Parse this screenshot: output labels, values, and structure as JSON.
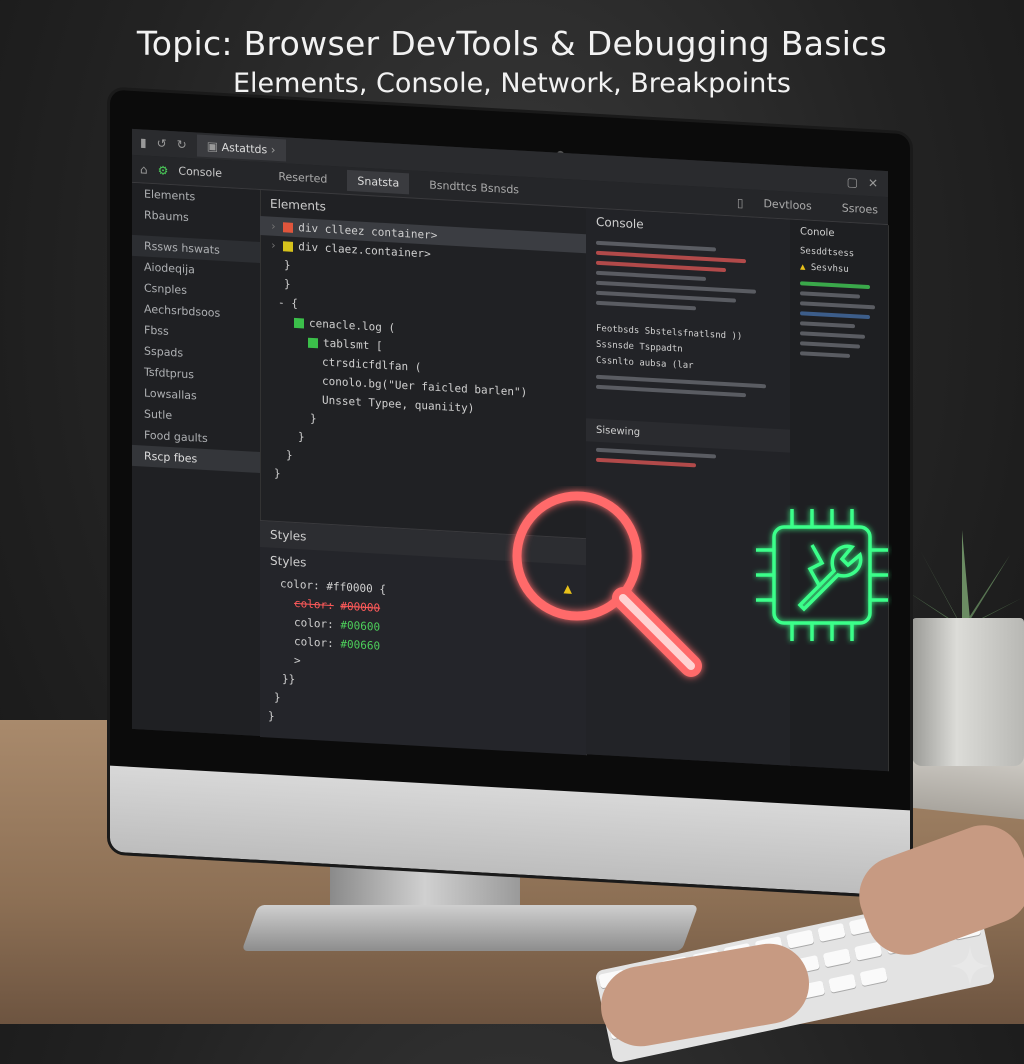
{
  "title": {
    "line1": "Topic: Browser DevTools & Debugging Basics",
    "line2": "Elements, Console, Network, Breakpoints"
  },
  "window": {
    "address_tab": "Astattds",
    "panel_label": "Console",
    "tabs": [
      "Reserted",
      "Snatsta",
      "Bsndttcs Bsnsds"
    ],
    "right_tabs": [
      "Devtloos",
      "Ssroes"
    ]
  },
  "sidebar": {
    "items": [
      "Elements",
      "Rbaums",
      "Rssws hswats",
      "Aiodeqija",
      "Csnples",
      "Aechsrbdsoos",
      "Fbss",
      "Sspads",
      "Tsfdtprus",
      "Lowsallas",
      "Sutle",
      "Food gaults",
      "Rscp fbes"
    ],
    "active_index": 12
  },
  "elements_panel": {
    "title": "Elements",
    "lines": [
      "div clleez container>",
      "div claez.container>",
      "}",
      "}",
      "- {",
      "cenacle.log (",
      "tablsmt [",
      "ctrsdicfdlfan (",
      "conolo.bg(\"Uer faicled barlen\")",
      "Unsset Typee, quaniity)",
      "}",
      "}",
      "}",
      "}"
    ]
  },
  "styles_panel": {
    "header": "Styles",
    "title": "Styles",
    "rules": [
      {
        "prefix": "color:",
        "value": "#ff0000 {",
        "kind": "normal"
      },
      {
        "prefix": "color:",
        "value": "#00000",
        "kind": "strike"
      },
      {
        "prefix": "color:",
        "value": "#00600",
        "kind": "green"
      },
      {
        "prefix": "color:",
        "value": "#00660",
        "kind": "green"
      }
    ],
    "closers": [
      ">",
      "}}",
      "}",
      "}"
    ]
  },
  "console_panel": {
    "title": "Console",
    "section": "Sisewing",
    "lines": [
      "Feotbsds Sbstelsfnatlsnd ))",
      "Sssnsde Tsppadtn",
      "Cssnlto aubsa (lar"
    ]
  },
  "network_panel": {
    "title": "Conole",
    "labels": [
      "Sesddtsess",
      "Sesvhsu"
    ]
  },
  "icons": {
    "magnifier_color": "#ff6b6b",
    "chip_color": "#3bff8a"
  }
}
